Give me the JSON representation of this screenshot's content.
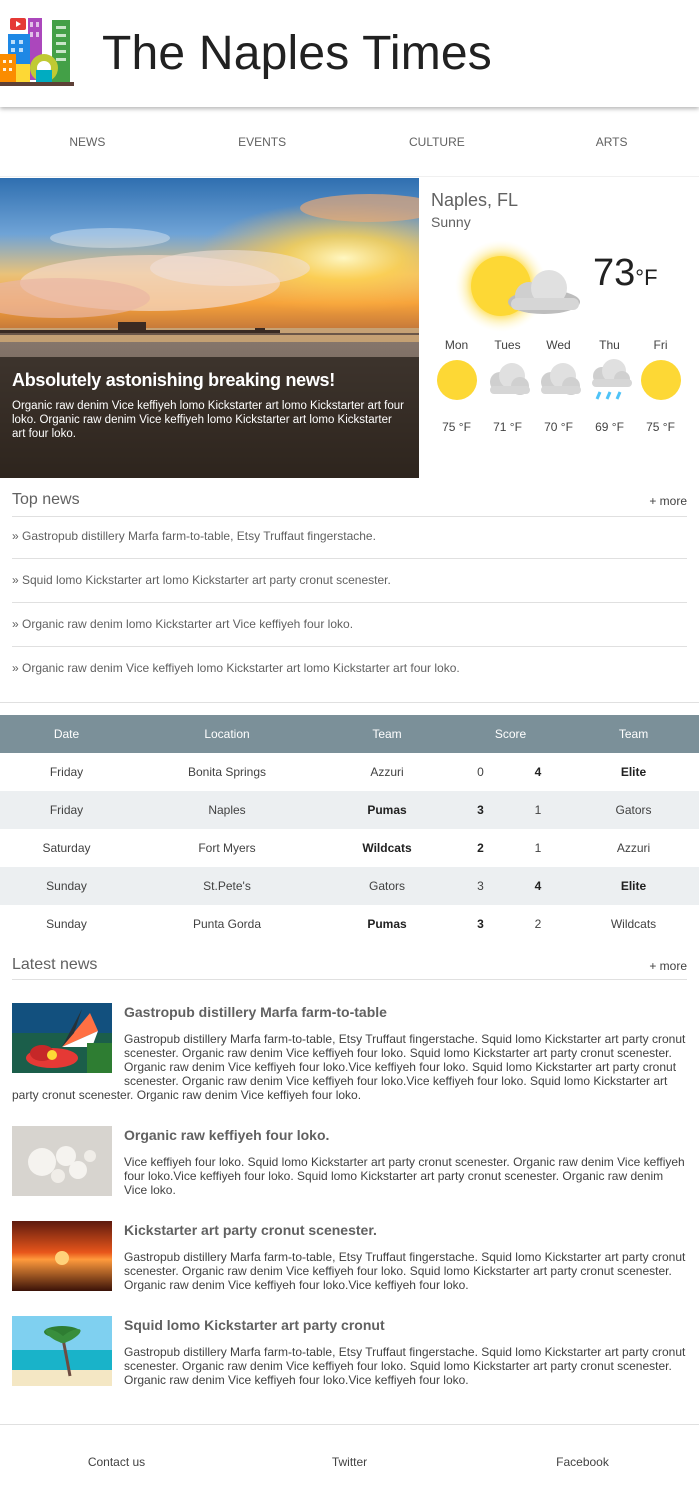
{
  "header": {
    "title": "The Naples Times",
    "logo_icon": "city-buildings-logo-icon"
  },
  "nav": [
    "NEWS",
    "EVENTS",
    "CULTURE",
    "ARTS"
  ],
  "hero": {
    "title": "Absolutely astonishing breaking news!",
    "text": "Organic raw denim Vice keffiyeh lomo Kickstarter art lomo Kickstarter art four loko. Organic raw denim Vice keffiyeh lomo Kickstarter art lomo Kickstarter art four loko."
  },
  "weather": {
    "city": "Naples, FL",
    "condition": "Sunny",
    "temp": "73",
    "unit": "°F",
    "forecast": [
      {
        "day": "Mon",
        "temp": "75 °F",
        "icon": "sun-icon"
      },
      {
        "day": "Tues",
        "temp": "71 °F",
        "icon": "cloud-icon"
      },
      {
        "day": "Wed",
        "temp": "70 °F",
        "icon": "cloud-icon"
      },
      {
        "day": "Thu",
        "temp": "69 °F",
        "icon": "rain-icon"
      },
      {
        "day": "Fri",
        "temp": "75 °F",
        "icon": "sun-icon"
      }
    ]
  },
  "top_news": {
    "title": "Top news",
    "more": "+ more",
    "items": [
      "» Gastropub distillery Marfa farm-to-table, Etsy Truffaut fingerstache.",
      "» Squid lomo Kickstarter art lomo Kickstarter art party cronut scenester.",
      "» Organic raw denim lomo Kickstarter art Vice keffiyeh four loko.",
      "» Organic raw denim Vice keffiyeh lomo Kickstarter art lomo Kickstarter art four loko."
    ]
  },
  "scores": {
    "headers": [
      "Date",
      "Location",
      "Team",
      "Score",
      "Team"
    ],
    "rows": [
      {
        "date": "Friday",
        "location": "Bonita Springs",
        "team1": "Azzuri",
        "s1": "0",
        "s2": "4",
        "team2": "Elite",
        "winner": 2
      },
      {
        "date": "Friday",
        "location": "Naples",
        "team1": "Pumas",
        "s1": "3",
        "s2": "1",
        "team2": "Gators",
        "winner": 1
      },
      {
        "date": "Saturday",
        "location": "Fort Myers",
        "team1": "Wildcats",
        "s1": "2",
        "s2": "1",
        "team2": "Azzuri",
        "winner": 1
      },
      {
        "date": "Sunday",
        "location": "St.Pete's",
        "team1": "Gators",
        "s1": "3",
        "s2": "4",
        "team2": "Elite",
        "winner": 2
      },
      {
        "date": "Sunday",
        "location": "Punta Gorda",
        "team1": "Pumas",
        "s1": "3",
        "s2": "2",
        "team2": "Wildcats",
        "winner": 1
      }
    ]
  },
  "latest_news": {
    "title": "Latest news",
    "more": "+ more",
    "items": [
      {
        "title": "Gastropub distillery Marfa farm-to-table",
        "image": "butterfly",
        "body": "Gastropub distillery Marfa farm-to-table, Etsy Truffaut fingerstache. Squid lomo Kickstarter art party cronut scenester. Organic raw denim Vice keffiyeh four loko. Squid lomo Kickstarter art party cronut scenester. Organic raw denim Vice keffiyeh four loko.Vice keffiyeh four loko. Squid lomo Kickstarter art party cronut scenester. Organic raw denim Vice keffiyeh four loko.Vice keffiyeh four loko. Squid lomo Kickstarter art party cronut scenester. Organic raw denim Vice keffiyeh four loko."
      },
      {
        "title": "Organic raw keffiyeh four loko.",
        "image": "sand-dollars",
        "body": "Vice keffiyeh four loko. Squid lomo Kickstarter art party cronut scenester. Organic raw denim Vice keffiyeh four loko.Vice keffiyeh four loko. Squid lomo Kickstarter art party cronut scenester. Organic raw denim Vice loko."
      },
      {
        "title": "Kickstarter art party cronut scenester.",
        "image": "sunset-sea",
        "body": "Gastropub distillery Marfa farm-to-table, Etsy Truffaut fingerstache. Squid lomo Kickstarter art party cronut scenester. Organic raw denim Vice keffiyeh four loko. Squid lomo Kickstarter art party cronut scenester. Organic raw denim Vice keffiyeh four loko.Vice keffiyeh four loko."
      },
      {
        "title": "Squid lomo Kickstarter art party cronut",
        "image": "palm-beach",
        "body": "Gastropub distillery Marfa farm-to-table, Etsy Truffaut fingerstache. Squid lomo Kickstarter art party cronut scenester. Organic raw denim Vice keffiyeh four loko. Squid lomo Kickstarter art party cronut scenester. Organic raw denim Vice keffiyeh four loko.Vice keffiyeh four loko."
      }
    ]
  },
  "footer": [
    "Contact us",
    "Twitter",
    "Facebook"
  ],
  "colors": {
    "table_header": "#7b9099",
    "table_alt_row": "#eceff1",
    "sun": "#fdd835"
  }
}
